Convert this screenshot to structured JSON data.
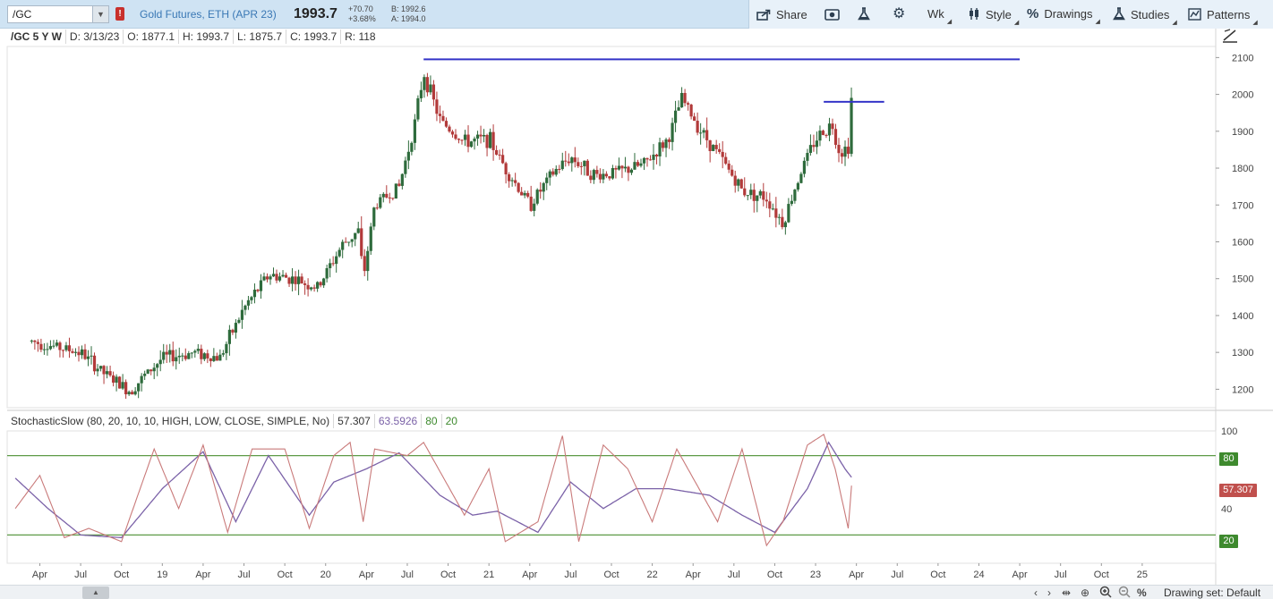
{
  "toolbar": {
    "symbol": "/GC",
    "alert_badge": "!",
    "description": "Gold Futures, ETH (APR 23)",
    "last_price": "1993.7",
    "net_change": "+70.70",
    "pct_change": "+3.68%",
    "bid": "B: 1992.6",
    "ask": "A: 1994.0",
    "share_label": "Share",
    "timeframe_label": "Wk",
    "style_label": "Style",
    "drawings_label": "Drawings",
    "studies_label": "Studies",
    "patterns_label": "Patterns"
  },
  "infobar": {
    "symbol_period": "/GC 5 Y W",
    "date": "D: 3/13/23",
    "open": "O: 1877.1",
    "high": "H: 1993.7",
    "low": "L: 1875.7",
    "close": "C: 1993.7",
    "range": "R: 118"
  },
  "study": {
    "name": "StochasticSlow (80, 20, 10, 10, HIGH, LOW, CLOSE, SIMPLE, No)",
    "value_k": "57.307",
    "value_d": "63.5926",
    "overbought": "80",
    "oversold": "20",
    "badge_value": "57.307",
    "axis_top": "100",
    "axis_mid": "40"
  },
  "bottom": {
    "drawing_set": "Drawing set: Default"
  },
  "colors": {
    "up": "#2e6b3c",
    "down": "#b23a3a",
    "k_line": "#c97a7a",
    "d_line": "#7b62a8",
    "level_line": "#5e9a47",
    "resistance": "#3434c8"
  },
  "chart_data": {
    "type": "candlestick",
    "y_ticks": [
      "2100",
      "2000",
      "1900",
      "1800",
      "1700",
      "1600",
      "1500",
      "1400",
      "1300",
      "1200"
    ],
    "y_range": [
      1150,
      2130
    ],
    "x_tick_labels": [
      "Apr",
      "Jul",
      "Oct",
      "19",
      "Apr",
      "Jul",
      "Oct",
      "20",
      "Apr",
      "Jul",
      "Oct",
      "21",
      "Apr",
      "Jul",
      "Oct",
      "22",
      "Apr",
      "Jul",
      "Oct",
      "23",
      "Apr",
      "Jul",
      "Oct",
      "24",
      "Apr",
      "Jul",
      "Oct",
      "25"
    ],
    "price_path": [
      [
        2018.2,
        1330
      ],
      [
        2018.5,
        1300
      ],
      [
        2018.65,
        1240
      ],
      [
        2018.8,
        1195
      ],
      [
        2019.0,
        1285
      ],
      [
        2019.2,
        1300
      ],
      [
        2019.35,
        1285
      ],
      [
        2019.5,
        1420
      ],
      [
        2019.65,
        1510
      ],
      [
        2019.8,
        1500
      ],
      [
        2019.95,
        1475
      ],
      [
        2020.1,
        1590
      ],
      [
        2020.2,
        1630
      ],
      [
        2020.23,
        1500
      ],
      [
        2020.3,
        1700
      ],
      [
        2020.45,
        1750
      ],
      [
        2020.55,
        1930
      ],
      [
        2020.6,
        2060
      ],
      [
        2020.7,
        1930
      ],
      [
        2020.85,
        1870
      ],
      [
        2021.0,
        1880
      ],
      [
        2021.1,
        1800
      ],
      [
        2021.25,
        1700
      ],
      [
        2021.4,
        1790
      ],
      [
        2021.5,
        1830
      ],
      [
        2021.65,
        1780
      ],
      [
        2021.8,
        1790
      ],
      [
        2021.95,
        1810
      ],
      [
        2022.1,
        1880
      ],
      [
        2022.18,
        1990
      ],
      [
        2022.3,
        1900
      ],
      [
        2022.4,
        1840
      ],
      [
        2022.55,
        1740
      ],
      [
        2022.7,
        1720
      ],
      [
        2022.8,
        1650
      ],
      [
        2022.9,
        1780
      ],
      [
        2023.0,
        1880
      ],
      [
        2023.1,
        1920
      ],
      [
        2023.15,
        1840
      ],
      [
        2023.2,
        1860
      ],
      [
        2023.22,
        1993.7
      ]
    ],
    "resistance_levels": [
      {
        "from": 2020.6,
        "to": 2024.25,
        "price": 2095
      },
      {
        "from": 2023.05,
        "to": 2023.42,
        "price": 1980
      }
    ],
    "stochastic_k_path": [
      [
        2018.1,
        40
      ],
      [
        2018.25,
        65
      ],
      [
        2018.4,
        18
      ],
      [
        2018.55,
        25
      ],
      [
        2018.75,
        15
      ],
      [
        2018.95,
        85
      ],
      [
        2019.1,
        40
      ],
      [
        2019.25,
        88
      ],
      [
        2019.4,
        22
      ],
      [
        2019.55,
        85
      ],
      [
        2019.75,
        85
      ],
      [
        2019.9,
        25
      ],
      [
        2020.05,
        80
      ],
      [
        2020.15,
        90
      ],
      [
        2020.23,
        30
      ],
      [
        2020.3,
        85
      ],
      [
        2020.5,
        80
      ],
      [
        2020.6,
        90
      ],
      [
        2020.85,
        35
      ],
      [
        2021.0,
        70
      ],
      [
        2021.1,
        15
      ],
      [
        2021.3,
        30
      ],
      [
        2021.45,
        95
      ],
      [
        2021.55,
        15
      ],
      [
        2021.7,
        88
      ],
      [
        2021.85,
        70
      ],
      [
        2022.0,
        30
      ],
      [
        2022.15,
        85
      ],
      [
        2022.4,
        30
      ],
      [
        2022.55,
        85
      ],
      [
        2022.7,
        12
      ],
      [
        2022.8,
        30
      ],
      [
        2022.95,
        88
      ],
      [
        2023.05,
        96
      ],
      [
        2023.12,
        70
      ],
      [
        2023.2,
        25
      ],
      [
        2023.22,
        57.3
      ]
    ],
    "stochastic_d_path": [
      [
        2018.1,
        63
      ],
      [
        2018.3,
        40
      ],
      [
        2018.5,
        20
      ],
      [
        2018.75,
        18
      ],
      [
        2019.0,
        55
      ],
      [
        2019.25,
        83
      ],
      [
        2019.45,
        30
      ],
      [
        2019.65,
        80
      ],
      [
        2019.9,
        35
      ],
      [
        2020.05,
        60
      ],
      [
        2020.25,
        70
      ],
      [
        2020.45,
        82
      ],
      [
        2020.7,
        50
      ],
      [
        2020.9,
        35
      ],
      [
        2021.05,
        38
      ],
      [
        2021.3,
        22
      ],
      [
        2021.5,
        60
      ],
      [
        2021.7,
        40
      ],
      [
        2021.9,
        55
      ],
      [
        2022.1,
        55
      ],
      [
        2022.35,
        50
      ],
      [
        2022.55,
        35
      ],
      [
        2022.75,
        22
      ],
      [
        2022.95,
        55
      ],
      [
        2023.08,
        90
      ],
      [
        2023.18,
        70
      ],
      [
        2023.22,
        63.6
      ]
    ]
  }
}
